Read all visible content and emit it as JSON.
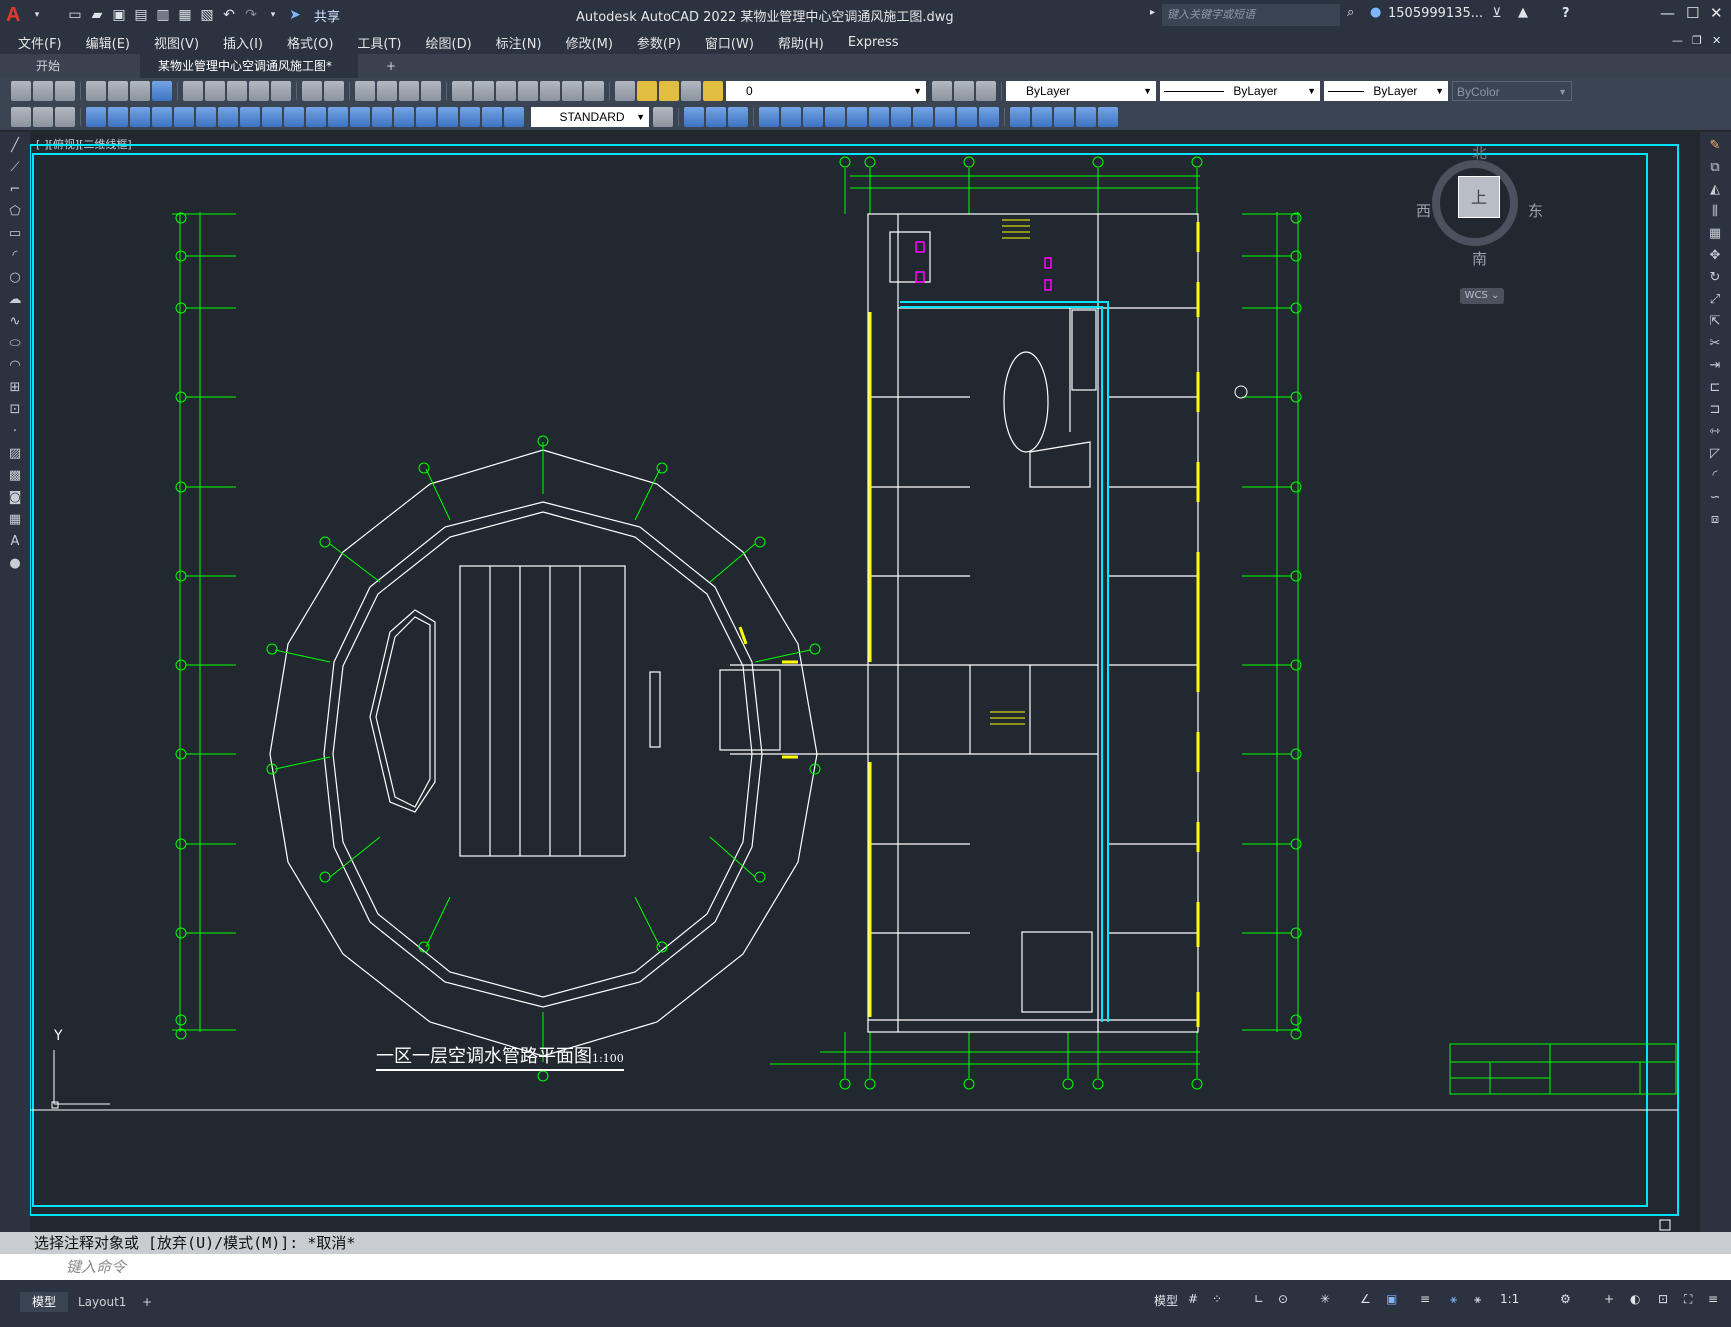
{
  "app": {
    "title": "Autodesk AutoCAD 2022    某物业管理中心空调通风施工图.dwg",
    "share": "共享",
    "search_placeholder": "键入关键字或短语",
    "user": "1505999135...",
    "help": "?"
  },
  "menu": [
    "文件(F)",
    "编辑(E)",
    "视图(V)",
    "插入(I)",
    "格式(O)",
    "工具(T)",
    "绘图(D)",
    "标注(N)",
    "修改(M)",
    "参数(P)",
    "窗口(W)",
    "帮助(H)",
    "Express"
  ],
  "tabs": {
    "start": "开始",
    "doc": "某物业管理中心空调通风施工图*",
    "close": "✕",
    "add": "+"
  },
  "properties": {
    "layer": "0",
    "text_style": "STANDARD",
    "color": "ByLayer",
    "linetype": "ByLayer",
    "lineweight": "ByLayer",
    "plotstyle": "ByColor"
  },
  "viewport": {
    "label": "[-][俯视][二维线框]",
    "compass": {
      "north": "北",
      "south": "南",
      "east": "东",
      "west": "西",
      "top": "上"
    },
    "wcs": "WCS ⌄",
    "ucs_y": "Y"
  },
  "drawing": {
    "title": "一区一层空调水管路平面图",
    "scale": "1:100",
    "line_color": "#ffffff",
    "axis_color": "#00ff00",
    "pipe_color": "#00e5ff",
    "wall_color": "#ffff00",
    "accent_magenta": "#ff00ff"
  },
  "command": {
    "history": "选择注释对象或 [放弃(U)/模式(M)]: *取消*",
    "prompt": "键入命令"
  },
  "layouts": [
    "模型",
    "Layout1",
    "+"
  ],
  "status": {
    "model": "模型",
    "scale": "1:1"
  }
}
